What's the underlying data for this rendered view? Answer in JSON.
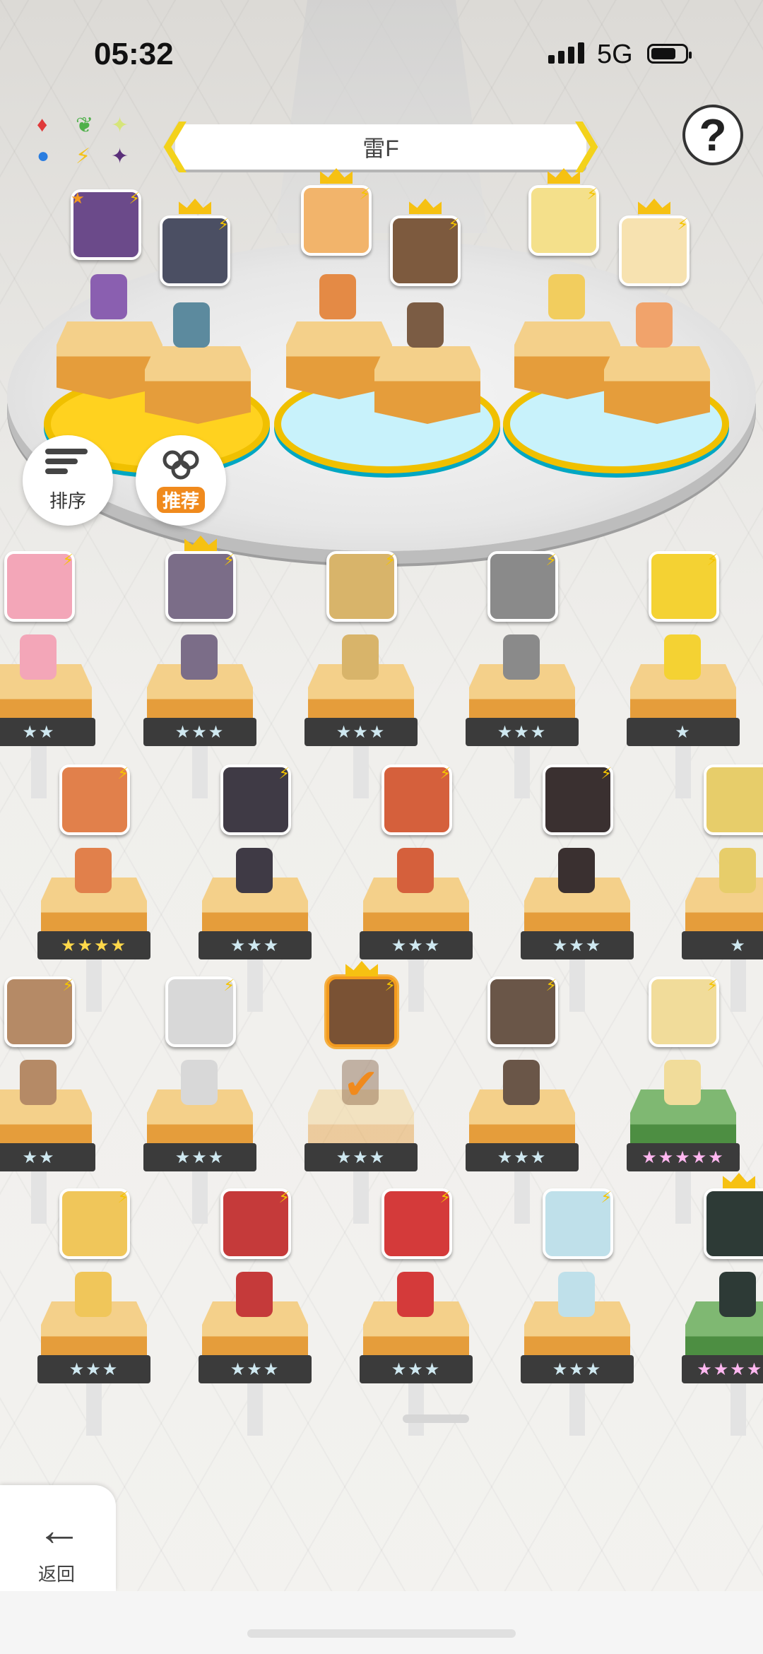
{
  "status": {
    "time": "05:32",
    "network": "5G"
  },
  "header": {
    "element_cycle": [
      "♦",
      "❦",
      "✦",
      "●",
      "⚡",
      "✦"
    ],
    "title": "雷F",
    "help_label": "?"
  },
  "buttons": {
    "sort_label": "排序",
    "recommend_label": "推荐",
    "back_label": "返回",
    "back_arrow": "←"
  },
  "colors": {
    "accent": "#f08a1d",
    "pad_yellow": "#ffd21f",
    "pad_blue": "#c8f2fb",
    "gold": "#f6c112"
  },
  "arena_units": [
    {
      "portrait_color": "#6b4a8a",
      "sprite_color": "#8a5fb0",
      "crown": false,
      "star_badge": true
    },
    {
      "portrait_color": "#4b4f63",
      "sprite_color": "#5c8a9e",
      "crown": true,
      "star_badge": false
    },
    {
      "portrait_color": "#f2b46b",
      "sprite_color": "#e48a45",
      "crown": true,
      "star_badge": false
    },
    {
      "portrait_color": "#7d5a3e",
      "sprite_color": "#7b5c44",
      "crown": true,
      "star_badge": false
    },
    {
      "portrait_color": "#f4e08b",
      "sprite_color": "#f2cd5e",
      "crown": true,
      "star_badge": false
    },
    {
      "portrait_color": "#f7e2b0",
      "sprite_color": "#f1a36b",
      "crown": true,
      "star_badge": false
    }
  ],
  "roster": [
    {
      "row": 1,
      "units": [
        {
          "portrait_color": "#f3a6b8",
          "stars": "★★",
          "style": "normal"
        },
        {
          "portrait_color": "#7b6d88",
          "stars": "★★★",
          "style": "normal",
          "crown": true
        },
        {
          "portrait_color": "#d8b46a",
          "stars": "★★★",
          "style": "normal"
        },
        {
          "portrait_color": "#8a8a8a",
          "stars": "★★★",
          "style": "normal"
        },
        {
          "portrait_color": "#f4d233",
          "stars": "★",
          "style": "normal"
        }
      ]
    },
    {
      "row": 2,
      "units": [
        {
          "portrait_color": "#e1804b",
          "stars": "★★★★",
          "style": "gold"
        },
        {
          "portrait_color": "#3f3a45",
          "stars": "★★★",
          "style": "normal"
        },
        {
          "portrait_color": "#d5603c",
          "stars": "★★★",
          "style": "normal"
        },
        {
          "portrait_color": "#3a3030",
          "stars": "★★★",
          "style": "normal"
        },
        {
          "portrait_color": "#e7cd6a",
          "stars": "★",
          "style": "normal"
        }
      ]
    },
    {
      "row": 3,
      "units": [
        {
          "portrait_color": "#b58a66",
          "stars": "★★",
          "style": "normal"
        },
        {
          "portrait_color": "#d8d8d8",
          "stars": "★★★",
          "style": "normal"
        },
        {
          "portrait_color": "#7a5234",
          "stars": "★★★",
          "style": "selected",
          "crown": true
        },
        {
          "portrait_color": "#6a5648",
          "stars": "★★★",
          "style": "normal"
        },
        {
          "portrait_color": "#f1dc9a",
          "stars": "★★★★★",
          "style": "rainbow",
          "green": true
        }
      ]
    },
    {
      "row": 4,
      "units": [
        {
          "portrait_color": "#f0c65a",
          "stars": "★★★",
          "style": "normal"
        },
        {
          "portrait_color": "#c53a3a",
          "stars": "★★★",
          "style": "normal"
        },
        {
          "portrait_color": "#d43a3a",
          "stars": "★★★",
          "style": "normal"
        },
        {
          "portrait_color": "#bfe0ea",
          "stars": "★★★",
          "style": "normal"
        },
        {
          "portrait_color": "#2d3a36",
          "stars": "★★★★★",
          "style": "rainbow",
          "green": true,
          "crown": true
        }
      ]
    }
  ]
}
